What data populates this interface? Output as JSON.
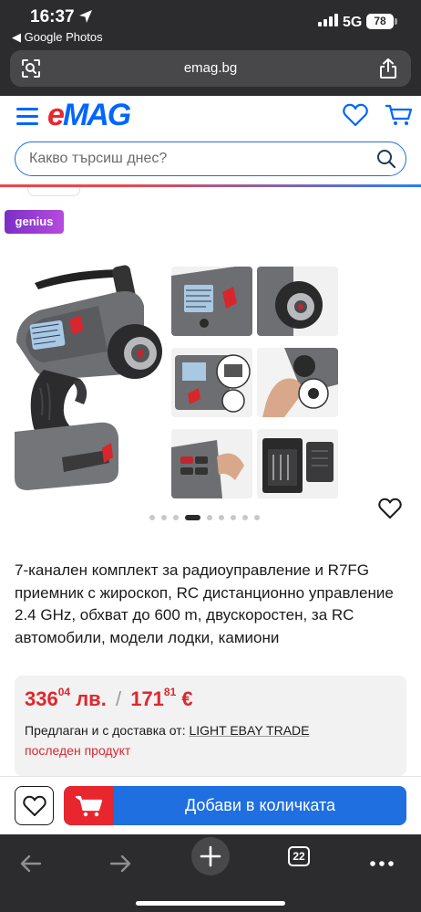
{
  "status": {
    "time": "16:37",
    "back_app": "◀ Google Photos",
    "network": "5G",
    "battery": "78"
  },
  "browser": {
    "url": "emag.bg",
    "tab_count": "22"
  },
  "header": {
    "logo_e": "e",
    "logo_rest": "MAG",
    "search_placeholder": "Какво търсиш днес?"
  },
  "badge": {
    "genius": "genius"
  },
  "gallery": {
    "image_count": 9,
    "active_index": 3
  },
  "product": {
    "title": "7-канален комплект за радиоуправление и R7FG приемник с жироскоп, RC дистанционно управление 2.4 GHz, обхват до 600 m, двускоростен, за RC автомобили, модели лодки, камиони",
    "price_bgn_int": "336",
    "price_bgn_dec": "04",
    "price_bgn_cur": "лв.",
    "price_sep": "/",
    "price_eur_int": "171",
    "price_eur_dec": "81",
    "price_eur_cur": "€",
    "seller_prefix": "Предлаган и с доставка от:",
    "seller_name": "LIGHT EBAY TRADE",
    "stock_status": "последен продукт"
  },
  "actions": {
    "add_to_cart": "Добави в количката"
  },
  "colors": {
    "brand_blue": "#0066ff",
    "brand_red": "#e8262d",
    "price_red": "#e0262d",
    "button_blue": "#1f6fe0"
  }
}
